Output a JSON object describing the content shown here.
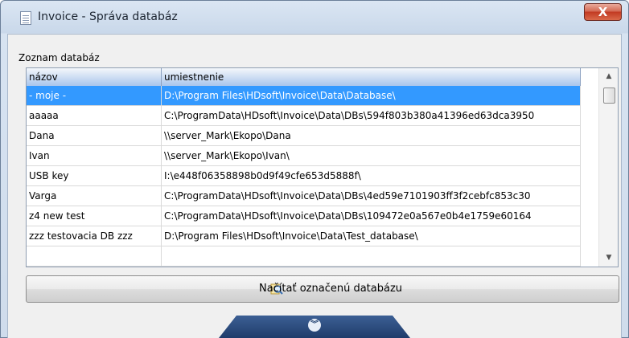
{
  "window": {
    "title": "Invoice - Správa databáz",
    "close_symbol": "X"
  },
  "group": {
    "label": "Zoznam databáz"
  },
  "grid": {
    "columns": [
      "názov",
      "umiestnenie"
    ],
    "rows": [
      {
        "name": "- moje -",
        "path": "D:\\Program Files\\HDsoft\\Invoice\\Data\\Database\\",
        "selected": true
      },
      {
        "name": "aaaaa",
        "path": "C:\\ProgramData\\HDsoft\\Invoice\\Data\\DBs\\594f803b380a41396ed63dca3950"
      },
      {
        "name": "Dana",
        "path": "\\\\server_Mark\\Ekopo\\Dana"
      },
      {
        "name": "Ivan",
        "path": "\\\\server_Mark\\Ekopo\\Ivan\\"
      },
      {
        "name": "USB key",
        "path": "I:\\e448f06358898b0d9f49cfe653d5888f\\"
      },
      {
        "name": "Varga",
        "path": "C:\\ProgramData\\HDsoft\\Invoice\\Data\\DBs\\4ed59e7101903ff3f2cebfc853c30"
      },
      {
        "name": "z4 new test",
        "path": "C:\\ProgramData\\HDsoft\\Invoice\\Data\\DBs\\109472e0a567e0b4e1759e60164"
      },
      {
        "name": "zzz testovacia DB zzz",
        "path": "D:\\Program Files\\HDsoft\\Invoice\\Data\\Test_database\\"
      }
    ]
  },
  "buttons": {
    "load_label": "Načítať označenú databázu"
  },
  "icons": {
    "app": "document-icon",
    "load": "search-icon",
    "expander": "chevron-double-down-icon"
  },
  "colors": {
    "selection": "#3399ff",
    "header": "#a9c5ec",
    "close": "#c23a22"
  }
}
